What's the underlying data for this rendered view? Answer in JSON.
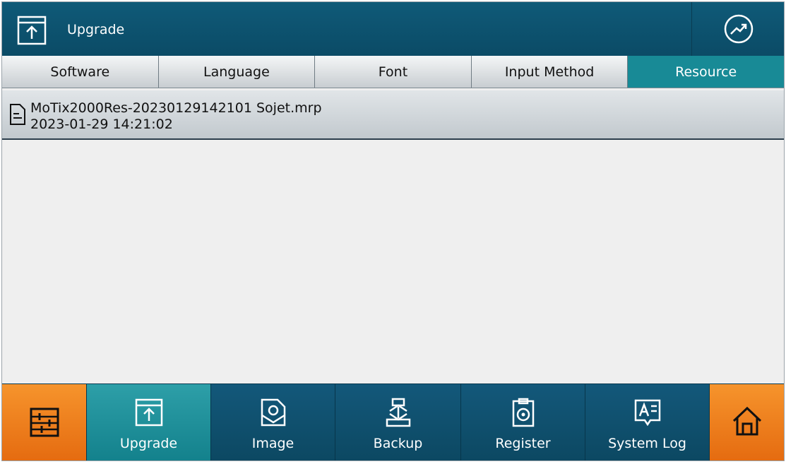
{
  "header": {
    "title": "Upgrade",
    "icon": "upload-box-icon",
    "trend_icon": "trend-chart-icon"
  },
  "tabs": [
    {
      "label": "Software",
      "active": false
    },
    {
      "label": "Language",
      "active": false
    },
    {
      "label": "Font",
      "active": false
    },
    {
      "label": "Input Method",
      "active": false
    },
    {
      "label": "Resource",
      "active": true
    }
  ],
  "files": [
    {
      "name": "MoTix2000Res-20230129142101 Sojet.mrp",
      "date": "2023-01-29 14:21:02",
      "icon": "file-icon"
    }
  ],
  "bottom_nav": {
    "settings_icon": "sliders-icon",
    "items": [
      {
        "label": "Upgrade",
        "icon": "upload-box-icon",
        "selected": true
      },
      {
        "label": "Image",
        "icon": "image-tag-icon",
        "selected": false
      },
      {
        "label": "Backup",
        "icon": "backup-sync-icon",
        "selected": false
      },
      {
        "label": "Register",
        "icon": "clipboard-lock-icon",
        "selected": false
      },
      {
        "label": "System Log",
        "icon": "log-comment-icon",
        "selected": false
      }
    ],
    "home_icon": "home-icon"
  },
  "colors": {
    "header_bg": "#0b4b66",
    "active_tab": "#188a96",
    "orange": "#f08020",
    "nav_bg": "#0e4f6c"
  }
}
